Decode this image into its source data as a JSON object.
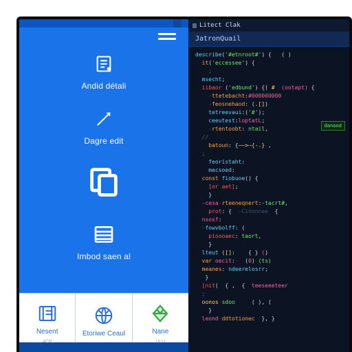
{
  "colors": {
    "brand_blue": "#1a73e8",
    "tab_blue": "#122a52",
    "editor_bg": "#0c1424"
  },
  "device": {
    "topbar_tag": "",
    "menu": [
      {
        "name": "detail",
        "label": "Andid détali",
        "icon": "detail-icon"
      },
      {
        "name": "edit",
        "label": "Dagre edit",
        "icon": "pencil-icon"
      },
      {
        "name": "copy",
        "label": "",
        "icon": "copy-icon"
      },
      {
        "name": "list",
        "label": "Imbod saen al",
        "icon": "list-icon"
      }
    ],
    "tiles": [
      {
        "name": "recent",
        "label": "Nesent",
        "icon": "recent-icon",
        "sub": "4CP"
      },
      {
        "name": "browse",
        "label": "Etoriwe Ceaul",
        "icon": "globe-icon",
        "sub": ""
      },
      {
        "name": "name",
        "label": "Nane",
        "icon": "diamond-icon",
        "sub": "ULU"
      }
    ]
  },
  "editor": {
    "window_title": "Litect Clak",
    "active_tab": "JatronQuail",
    "badge": "danood",
    "code_lines": [
      {
        "seg": [
          [
            "c-fn",
            "describe"
          ],
          [
            "",
            "("
          ],
          [
            "c-str",
            "'#etnroot#'"
          ],
          [
            "",
            ") {   ( )"
          ]
        ]
      },
      {
        "seg": [
          [
            "",
            "  "
          ],
          [
            "c-key",
            "it"
          ],
          [
            "",
            "("
          ],
          [
            "c-str",
            "'eccessee'"
          ],
          [
            "",
            ") {"
          ]
        ]
      },
      {
        "seg": [
          [
            "",
            "    "
          ],
          [
            "c-com",
            ";"
          ]
        ]
      },
      {
        "seg": [
          [
            "",
            "  "
          ],
          [
            "c-fn",
            "msecht"
          ],
          [
            "c-op",
            ";"
          ]
        ]
      },
      {
        "seg": [
          [
            "",
            "  "
          ],
          [
            "c-red",
            "iibaor"
          ],
          [
            "",
            " ("
          ],
          [
            "c-str",
            "'edbund'"
          ],
          [
            "",
            ") {( "
          ],
          [
            "c-op",
            "#  "
          ],
          [
            "c-mag",
            "(ootapt)"
          ],
          [
            "",
            " {"
          ]
        ]
      },
      {
        "seg": [
          [
            "",
            "    "
          ],
          [
            "c-ws",
            "-"
          ],
          [
            "c-key",
            "ttetebacht"
          ],
          [
            "",
            ":"
          ],
          [
            "c-num",
            "#000000000"
          ]
        ]
      },
      {
        "seg": [
          [
            "",
            "    "
          ],
          [
            "c-ws",
            "-"
          ],
          [
            "c-key",
            "feosnehaod"
          ],
          [
            "",
            ": ("
          ],
          [
            "c-op",
            ".[]"
          ],
          [
            "",
            ")"
          ]
        ]
      },
      {
        "seg": [
          [
            "",
            "    "
          ],
          [
            "c-fn",
            "tetreevaui"
          ],
          [
            "",
            ":("
          ],
          [
            "c-str",
            "'#'"
          ],
          [
            "",
            ");"
          ]
        ]
      },
      {
        "seg": [
          [
            "",
            "    "
          ],
          [
            "c-fn",
            "ceeutest"
          ],
          [
            "",
            ":"
          ],
          [
            "c-mag",
            "loptatL"
          ],
          [
            "",
            ";"
          ]
        ]
      },
      {
        "seg": [
          [
            "",
            "    "
          ],
          [
            "c-ws",
            "-"
          ],
          [
            "c-key",
            "rtentoobt"
          ],
          [
            "",
            ": "
          ],
          [
            "c-str",
            "ntail"
          ],
          [
            "",
            ","
          ]
        ]
      },
      {
        "seg": [
          [
            "c-com",
            "  //"
          ]
        ]
      },
      {
        "seg": [
          [
            "",
            "    "
          ],
          [
            "c-key",
            "batoun"
          ],
          [
            "",
            ": {"
          ],
          [
            "c-op",
            "——>—{-.}"
          ],
          [
            "",
            " ,"
          ]
        ]
      },
      {
        "seg": [
          [
            "c-com",
            "  ;"
          ]
        ]
      },
      {
        "seg": [
          [
            "",
            "    "
          ],
          [
            "c-fn",
            "feoristaht"
          ],
          [
            "",
            ":"
          ]
        ]
      },
      {
        "seg": [
          [
            "",
            "    "
          ],
          [
            "c-fn",
            "mecsoed"
          ],
          [
            "",
            ":"
          ]
        ]
      },
      {
        "seg": [
          [
            "",
            "  "
          ],
          [
            "c-key",
            "const"
          ],
          [
            "",
            " "
          ],
          [
            "c-fn",
            "fiobuoe"
          ],
          [
            "",
            "() {"
          ]
        ]
      },
      {
        "seg": [
          [
            "",
            "    "
          ],
          [
            "c-red",
            "[or aet]"
          ],
          [
            "",
            ";"
          ]
        ]
      },
      {
        "seg": [
          [
            "",
            "    }"
          ]
        ]
      },
      {
        "seg": [
          [
            "",
            "  "
          ],
          [
            "c-mag",
            "-cesa"
          ],
          [
            "c-ws",
            "·"
          ],
          [
            "c-key",
            "rteeneqnert"
          ],
          [
            "",
            ":"
          ],
          [
            "c-str",
            "·tacrt#"
          ],
          [
            "",
            ","
          ]
        ]
      },
      {
        "seg": [
          [
            "",
            "    "
          ],
          [
            "c-red",
            "prot"
          ],
          [
            "",
            ": {  "
          ],
          [
            "c-ws",
            "·Cinonnee"
          ],
          [
            "",
            "  {"
          ]
        ]
      },
      {
        "seg": [
          [
            "",
            "  "
          ],
          [
            "c-mag",
            "nsosf"
          ],
          [
            "",
            ":"
          ]
        ]
      },
      {
        "seg": [
          [
            "",
            "  "
          ],
          [
            "c-com",
            "-"
          ],
          [
            "c-fn",
            "fowvbolff"
          ],
          [
            "",
            ": ("
          ]
        ]
      },
      {
        "seg": [
          [
            "",
            "    "
          ],
          [
            "c-red",
            "pioooaec"
          ],
          [
            "",
            ": "
          ],
          [
            "c-str",
            "taort"
          ],
          [
            "",
            ","
          ]
        ]
      },
      {
        "seg": [
          [
            "",
            "    }"
          ]
        ]
      },
      {
        "seg": [
          [
            "",
            "  "
          ],
          [
            "c-fn",
            "lteut"
          ],
          [
            "",
            " ("
          ],
          [
            "c-op",
            "[]"
          ],
          [
            "",
            ":    { } "
          ],
          [
            "c-num",
            "("
          ],
          [
            "",
            ")"
          ]
        ]
      },
      {
        "seg": [
          [
            "",
            "  "
          ],
          [
            "c-key",
            "var"
          ],
          [
            "",
            " "
          ],
          [
            "c-mag",
            "oecit"
          ],
          [
            "",
            ":"
          ],
          [
            "c-ws",
            "·"
          ],
          [
            "",
            "  ("
          ],
          [
            "c-num",
            "0"
          ],
          [
            "",
            ") "
          ],
          [
            "c-str",
            "(ts)"
          ]
        ]
      },
      {
        "seg": [
          [
            "",
            "  "
          ],
          [
            "c-key",
            "meanes"
          ],
          [
            "",
            ":"
          ],
          [
            "c-ws",
            "·"
          ],
          [
            "c-fn",
            "ndeerelosrr"
          ],
          [
            "",
            ";"
          ]
        ]
      },
      {
        "seg": [
          [
            "",
            "   }"
          ]
        ]
      },
      {
        "seg": [
          [
            "c-red",
            "  [nit"
          ],
          [
            "",
            "(  { ,  {  "
          ],
          [
            "c-mag",
            "teeseeeteer"
          ]
        ]
      },
      {
        "seg": [
          [
            "c-com",
            "  ;"
          ]
        ]
      },
      {
        "seg": [
          [
            "",
            "  "
          ],
          [
            "c-op",
            "oonos"
          ],
          [
            "c-ws",
            "·"
          ],
          [
            "c-str",
            "sdoo"
          ],
          [
            "",
            "     ( ), ("
          ]
        ]
      },
      {
        "seg": [
          [
            "",
            "    }"
          ]
        ]
      },
      {
        "seg": [
          [
            "",
            "  "
          ],
          [
            "c-mag",
            "leond"
          ],
          [
            "c-ws",
            "·"
          ],
          [
            "c-key",
            "ddtotionec"
          ],
          [
            "",
            "  }, }"
          ]
        ]
      }
    ]
  }
}
